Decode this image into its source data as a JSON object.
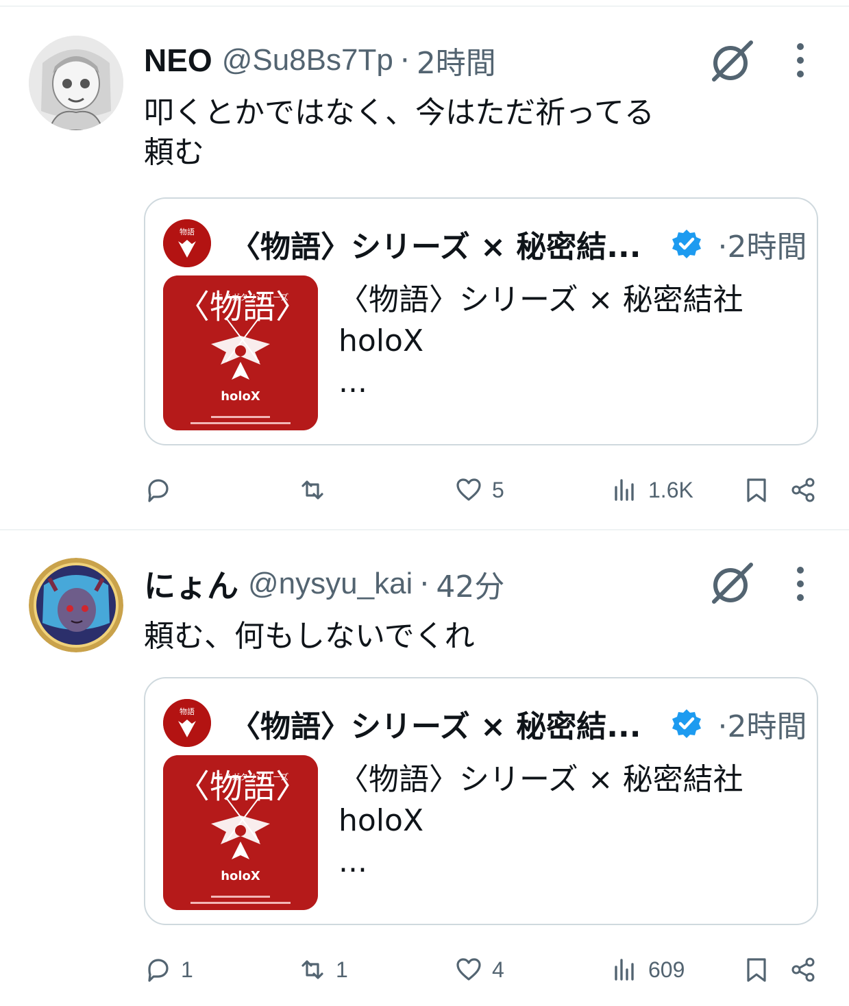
{
  "tweets": [
    {
      "name": "NEO",
      "handle": "@Su8Bs7Tp",
      "dot": "·",
      "time": "2時間",
      "text_lines": [
        "叩くとかではなく、今はただ祈ってる",
        "頼む"
      ],
      "quote": {
        "name": "〈物語〉シリーズ × 秘密結...",
        "dot": "·",
        "time": "2時間",
        "text_lines": [
          "〈物語〉シリーズ × 秘密結社",
          "holoX",
          "..."
        ]
      },
      "actions": {
        "reply": "",
        "retweet": "",
        "like": "5",
        "views": "1.6K"
      }
    },
    {
      "name": "にょん",
      "handle": "@nysyu_kai",
      "dot": "·",
      "time": "42分",
      "text_lines": [
        "頼む、何もしないでくれ"
      ],
      "quote": {
        "name": "〈物語〉シリーズ × 秘密結...",
        "dot": "·",
        "time": "2時間",
        "text_lines": [
          "〈物語〉シリーズ × 秘密結社",
          "holoX",
          "..."
        ]
      },
      "actions": {
        "reply": "1",
        "retweet": "1",
        "like": "4",
        "views": "609"
      }
    }
  ],
  "thumbnail": {
    "title": "〈物語〉",
    "subtitle": "モノガタリシリーズ",
    "brand": "holoX"
  },
  "icons": {
    "reply": "reply-icon",
    "retweet": "retweet-icon",
    "like": "heart-icon",
    "views": "views-icon",
    "bookmark": "bookmark-icon",
    "share": "share-icon",
    "grok": "grok-icon",
    "more": "more-icon",
    "verified": "verified-badge-icon"
  },
  "colors": {
    "text": "#0f1419",
    "secondary": "#536471",
    "verified": "#1d9bf0",
    "thumbnail_red": "#b51a1a",
    "border": "#cfd9de"
  }
}
